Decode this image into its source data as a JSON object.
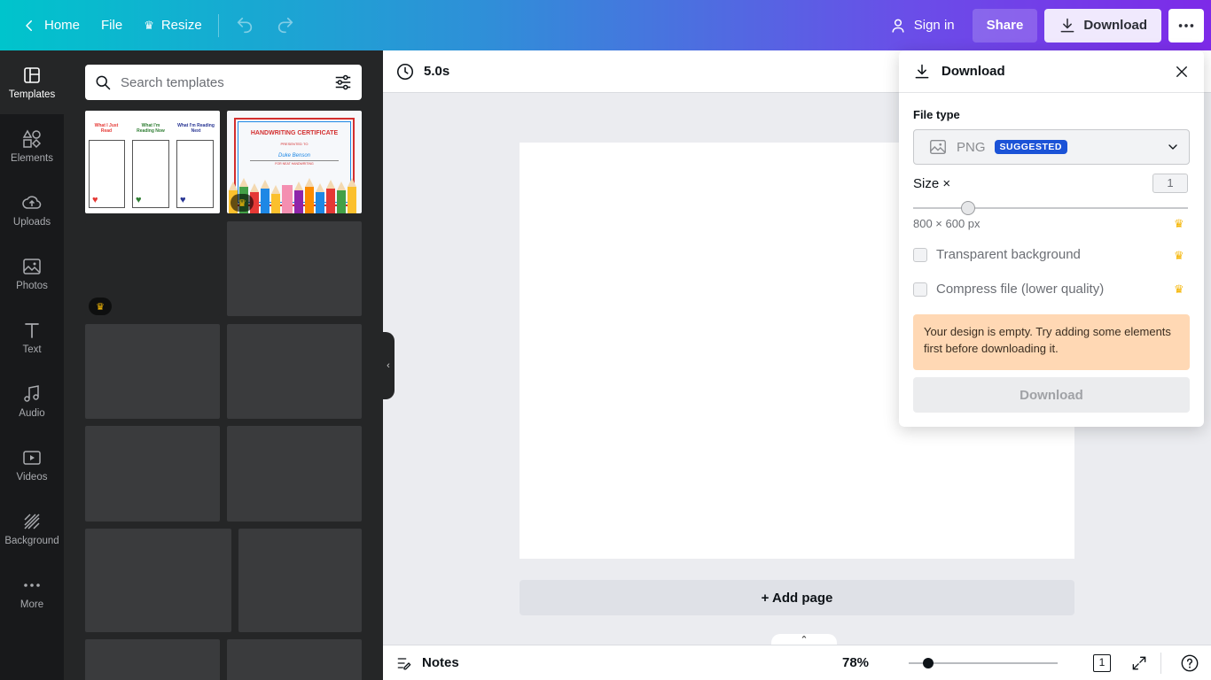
{
  "topbar": {
    "home_label": "Home",
    "file_label": "File",
    "resize_label": "Resize",
    "signin_label": "Sign in",
    "share_label": "Share",
    "download_label": "Download"
  },
  "rail": {
    "items": [
      {
        "label": "Templates"
      },
      {
        "label": "Elements"
      },
      {
        "label": "Uploads"
      },
      {
        "label": "Photos"
      },
      {
        "label": "Text"
      },
      {
        "label": "Audio"
      },
      {
        "label": "Videos"
      },
      {
        "label": "Background"
      },
      {
        "label": "More"
      }
    ]
  },
  "panel": {
    "search_placeholder": "Search templates",
    "template1": {
      "columns": [
        "What I Just Read",
        "What I'm Reading Now",
        "What I'm Reading Next"
      ]
    },
    "template2": {
      "title": "HANDWRITING CERTIFICATE",
      "presented": "PRESENTED TO",
      "name": "Duke Benson",
      "sub": "FOR NEAT HANDWRITING"
    }
  },
  "canvas": {
    "timing": "5.0s",
    "add_page": "+ Add page"
  },
  "bottombar": {
    "notes_label": "Notes",
    "zoom": "78%",
    "page_count": "1"
  },
  "download_panel": {
    "title": "Download",
    "file_type_label": "File type",
    "file_type_value": "PNG",
    "suggested_badge": "SUGGESTED",
    "size_label": "Size ×",
    "size_value": "1",
    "size_fraction": 0.2,
    "dimensions": "800 × 600 px",
    "transparent_label": "Transparent background",
    "compress_label": "Compress file (lower quality)",
    "warning": "Your design is empty. Try adding some elements first before downloading it.",
    "download_button": "Download"
  }
}
